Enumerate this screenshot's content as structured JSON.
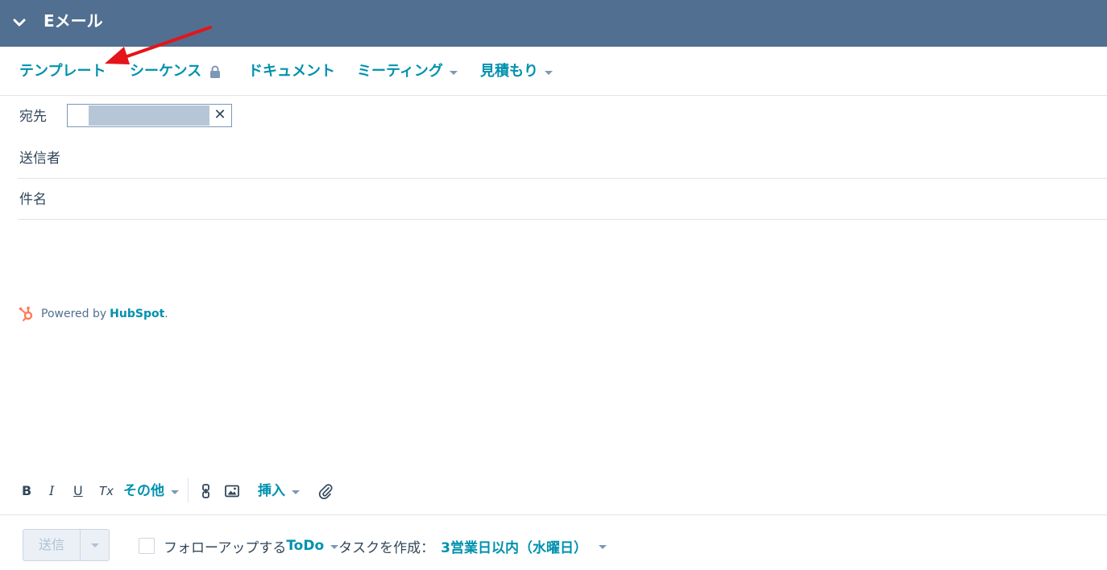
{
  "header": {
    "title": "Eメール",
    "collapse_icon": "chevron-down-icon"
  },
  "toolbar": {
    "template": "テンプレート",
    "sequence": "シーケンス",
    "document": "ドキュメント",
    "meeting": "ミーティング",
    "quote": "見積もり"
  },
  "fields": {
    "to_label": "宛先",
    "from_label": "送信者",
    "subject_label": "件名",
    "remove_symbol": "✕"
  },
  "body": {
    "powered_prefix": "Powered by",
    "powered_brand": "HubSpot",
    "powered_suffix": "."
  },
  "format": {
    "bold": "B",
    "italic": "I",
    "underline": "U",
    "clear": "Tx",
    "more": "その他",
    "insert": "挿入"
  },
  "footer": {
    "send": "送信",
    "followup_prefix": "フォローアップする",
    "todo": "ToDo",
    "task_label": "タスクを作成：",
    "due": "3営業日以内（水曜日）"
  },
  "colors": {
    "header_bg": "#516f90",
    "link": "#0091ae",
    "arrow": "#e5141a",
    "hubspot_orange": "#ff7a59"
  }
}
